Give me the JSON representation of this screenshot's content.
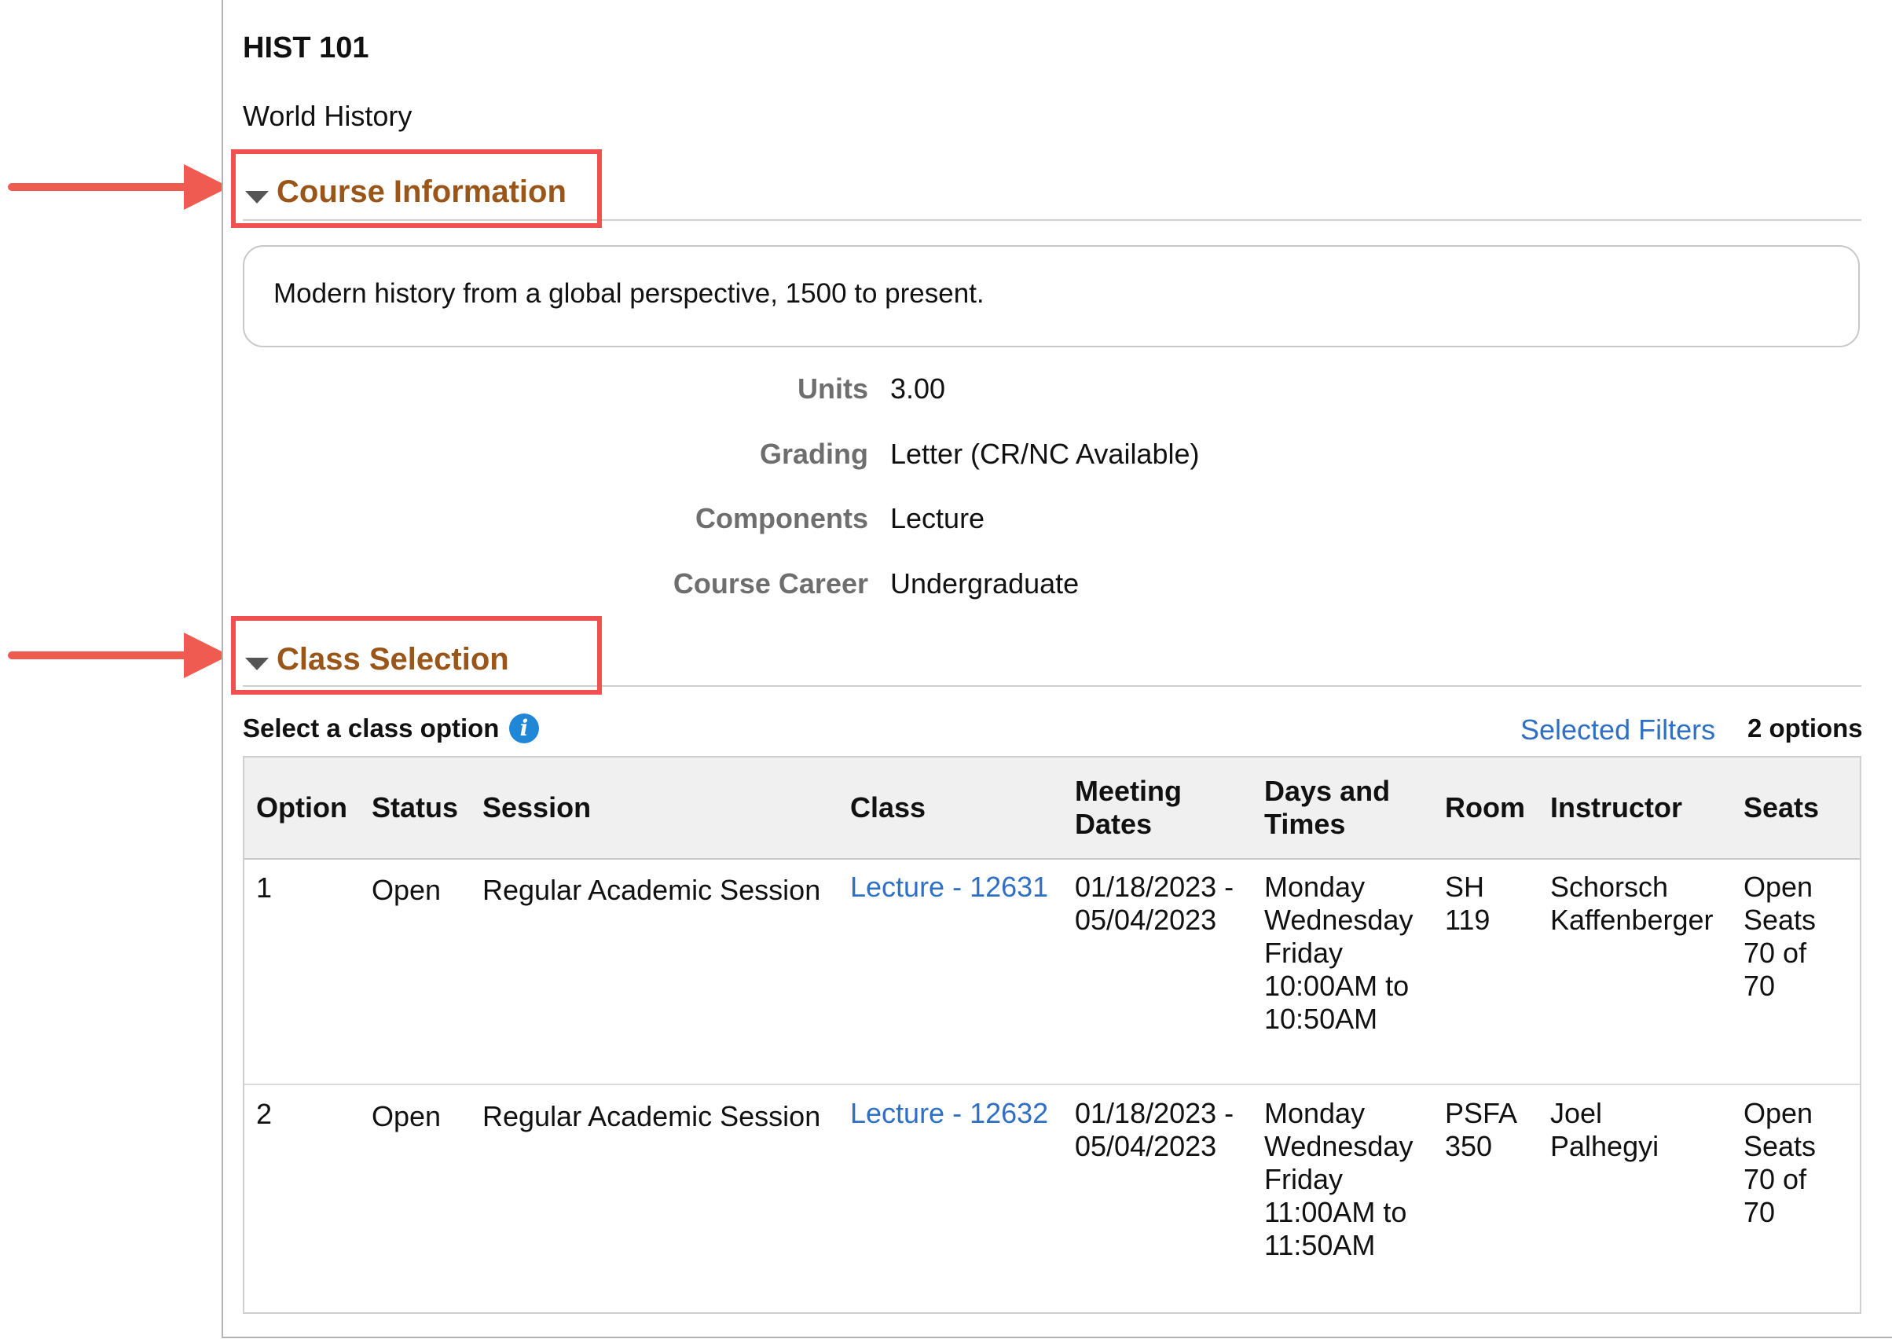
{
  "course": {
    "code": "HIST 101",
    "title": "World History"
  },
  "course_info": {
    "heading": "Course Information",
    "description": "Modern history from a global perspective, 1500 to present.",
    "fields": [
      {
        "label": "Units",
        "value": "3.00"
      },
      {
        "label": "Grading",
        "value": "Letter (CR/NC Available)"
      },
      {
        "label": "Components",
        "value": "Lecture"
      },
      {
        "label": "Course Career",
        "value": "Undergraduate"
      }
    ]
  },
  "class_selection": {
    "heading": "Class Selection",
    "select_label": "Select a class option",
    "info_icon_glyph": "i",
    "filters_link": "Selected Filters",
    "options_count": "2 options",
    "headers": {
      "option": "Option",
      "status": "Status",
      "session": "Session",
      "class": "Class",
      "meeting_dates_1": "Meeting",
      "meeting_dates_2": "Dates",
      "days_times_1": "Days and",
      "days_times_2": "Times",
      "room": "Room",
      "instructor": "Instructor",
      "seats": "Seats"
    },
    "rows": [
      {
        "option": "1",
        "status": "Open",
        "session": "Regular Academic Session",
        "class_link": "Lecture - 12631",
        "dates": [
          "01/18/2023 -",
          "05/04/2023"
        ],
        "days_times": [
          "Monday",
          "Wednesday",
          "Friday",
          "10:00AM to",
          "10:50AM"
        ],
        "room": [
          "SH",
          "119"
        ],
        "instructor": [
          "Schorsch",
          "Kaffenberger"
        ],
        "seats": [
          "Open",
          "Seats",
          "70 of",
          "70"
        ]
      },
      {
        "option": "2",
        "status": "Open",
        "session": "Regular Academic Session",
        "class_link": "Lecture - 12632",
        "dates": [
          "01/18/2023 -",
          "05/04/2023"
        ],
        "days_times": [
          "Monday",
          "Wednesday",
          "Friday",
          "11:00AM to",
          "11:50AM"
        ],
        "room": [
          "PSFA",
          "350"
        ],
        "instructor": [
          "Joel",
          "Palhegyi"
        ],
        "seats": [
          "Open",
          "Seats",
          "70 of",
          "70"
        ]
      }
    ]
  },
  "colors": {
    "heading": "#9a5519",
    "link": "#2f6fc4",
    "callout": "#f0504f",
    "info_icon": "#1f87d6"
  }
}
